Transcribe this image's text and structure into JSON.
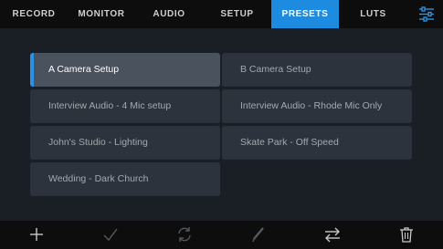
{
  "tabs": [
    {
      "label": "RECORD",
      "active": false
    },
    {
      "label": "MONITOR",
      "active": false
    },
    {
      "label": "AUDIO",
      "active": false
    },
    {
      "label": "SETUP",
      "active": false
    },
    {
      "label": "PRESETS",
      "active": true
    },
    {
      "label": "LUTS",
      "active": false
    }
  ],
  "settings_icon": "sliders-icon",
  "presets": [
    {
      "label": "A Camera Setup",
      "selected": true
    },
    {
      "label": "B Camera Setup",
      "selected": false
    },
    {
      "label": "Interview Audio - 4 Mic setup",
      "selected": false
    },
    {
      "label": "Interview Audio - Rhode Mic Only",
      "selected": false
    },
    {
      "label": "John's Studio - Lighting",
      "selected": false
    },
    {
      "label": "Skate Park - Off Speed",
      "selected": false
    },
    {
      "label": "Wedding  - Dark Church",
      "selected": false
    }
  ],
  "toolbar_icons": [
    "add-icon",
    "check-icon",
    "refresh-icon",
    "pencil-icon",
    "swap-icon",
    "trash-icon"
  ],
  "colors": {
    "accent": "#1d8ce0",
    "panel": "#1a1f26",
    "tile": "#2d333c",
    "tile_selected": "#4a525e",
    "bar": "#0d0d0e"
  }
}
